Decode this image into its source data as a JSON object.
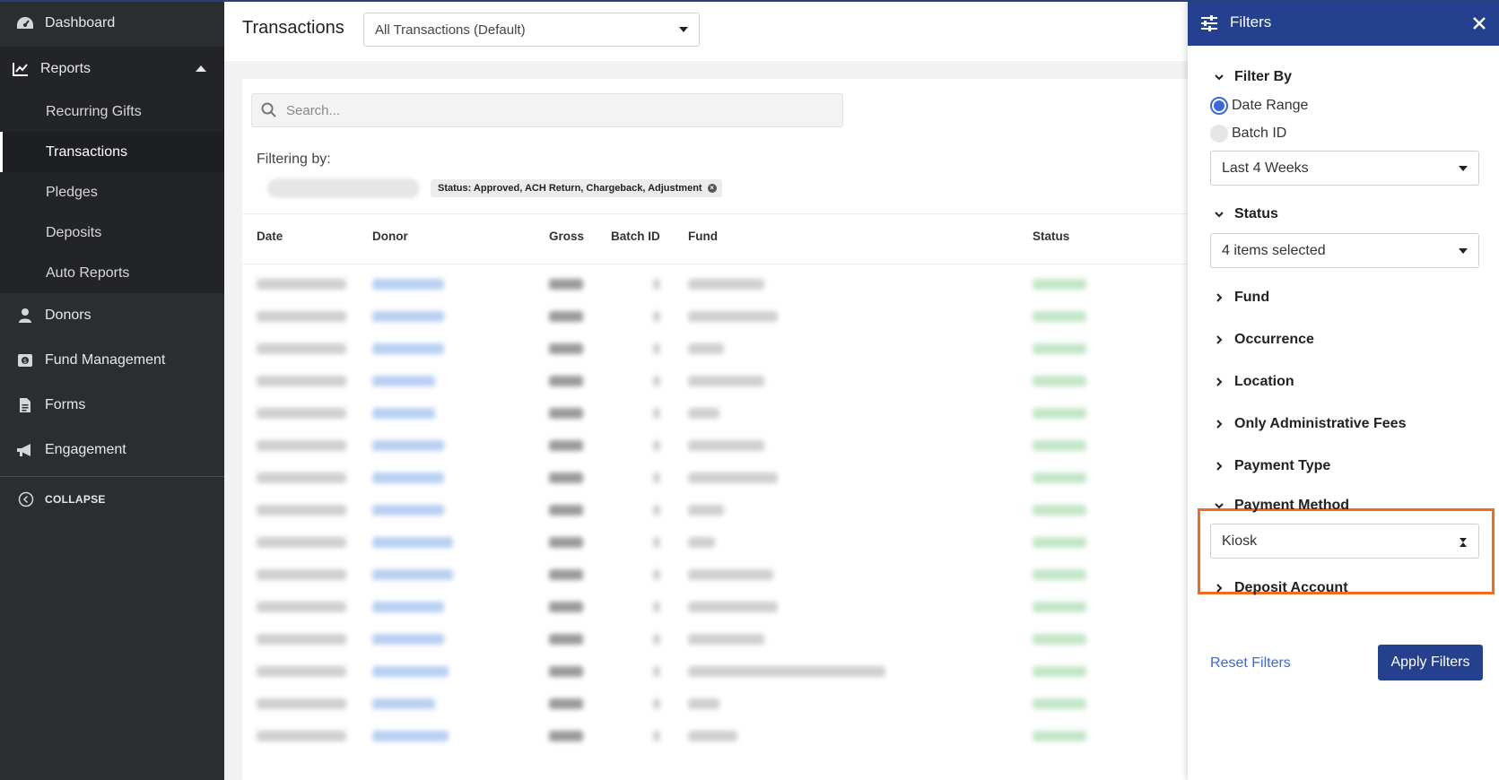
{
  "sidebar": {
    "items": [
      {
        "label": "Dashboard",
        "icon": "dashboard-icon"
      },
      {
        "label": "Reports",
        "icon": "chart-icon"
      },
      {
        "label": "Donors",
        "icon": "user-icon"
      },
      {
        "label": "Fund Management",
        "icon": "money-icon"
      },
      {
        "label": "Forms",
        "icon": "document-icon"
      },
      {
        "label": "Engagement",
        "icon": "megaphone-icon"
      }
    ],
    "reports_sub": [
      "Recurring Gifts",
      "Transactions",
      "Pledges",
      "Deposits",
      "Auto Reports"
    ],
    "active_sub": "Transactions",
    "collapse_label": "COLLAPSE"
  },
  "header": {
    "title": "Transactions",
    "view_select": "All Transactions (Default)"
  },
  "search": {
    "placeholder": "Search..."
  },
  "filtering": {
    "label": "Filtering by:",
    "status_chip": "Status: Approved, ACH Return, Chargeback, Adjustment"
  },
  "table": {
    "columns": [
      "Date",
      "Donor",
      "Gross",
      "Batch ID",
      "Fund",
      "Status"
    ]
  },
  "filters": {
    "title": "Filters",
    "filter_by": {
      "label": "Filter By",
      "options": [
        "Date Range",
        "Batch ID"
      ],
      "selected": "Date Range",
      "range_value": "Last 4 Weeks"
    },
    "status": {
      "label": "Status",
      "value": "4 items selected"
    },
    "collapsed_sections": [
      "Fund",
      "Occurrence",
      "Location",
      "Only Administrative Fees",
      "Payment Type"
    ],
    "payment_method": {
      "label": "Payment Method",
      "value": "Kiosk"
    },
    "deposit_account": "Deposit Account",
    "reset_label": "Reset Filters",
    "apply_label": "Apply Filters"
  },
  "colors": {
    "sidebar_bg": "#2b2e31",
    "drawer_header": "#24408e",
    "accent_blue": "#3d66e0",
    "highlight_orange": "#f26c1c"
  }
}
